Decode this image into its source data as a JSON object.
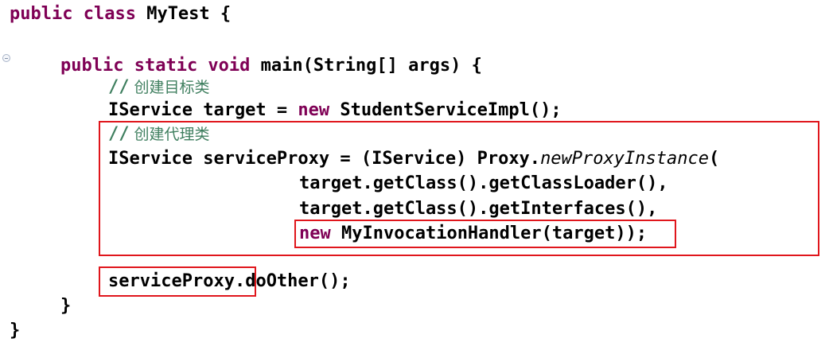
{
  "code": {
    "line1": {
      "kw": "public class",
      "rest": " MyTest {"
    },
    "line2": {
      "kw": "public static void",
      "rest": " main(String[] args) {"
    },
    "line3": {
      "slashes": "//",
      "comment": " 创建目标类"
    },
    "line4": {
      "pre": "IService target = ",
      "kw": "new",
      "post": " StudentServiceImpl();"
    },
    "line5": {
      "slashes": "//",
      "comment": " 创建代理类"
    },
    "line6": {
      "pre": "IService serviceProxy = (IService) Proxy.",
      "italic": "newProxyInstance",
      "post": "("
    },
    "line7": "target.getClass().getClassLoader(),",
    "line8": "target.getClass().getInterfaces(),",
    "line9": {
      "kw": "new",
      "mid": " MyInvocationHandler(target)",
      "post": ");"
    },
    "line10": {
      "obj": "serviceProxy",
      "post": ".doOther();"
    },
    "line11": "}",
    "line12": "}"
  },
  "colors": {
    "keyword": "#7f0055",
    "comment": "#3f7f5f",
    "highlight_box": "#e0161c"
  }
}
